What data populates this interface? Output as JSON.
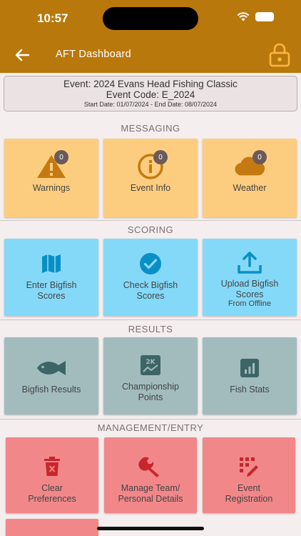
{
  "status": {
    "time": "10:57"
  },
  "appbar": {
    "title": "AFT Dashboard"
  },
  "event": {
    "name": "Event: 2024 Evans Head Fishing Classic",
    "code": "Event Code: E_2024",
    "dates": "Start Date: 01/07/2024 - End Date: 08/07/2024"
  },
  "sections": {
    "messaging": "MESSAGING",
    "scoring": "SCORING",
    "results": "RESULTS",
    "management": "MANAGEMENT/ENTRY"
  },
  "messaging": {
    "warnings": {
      "label": "Warnings",
      "badge": "0"
    },
    "event_info": {
      "label": "Event Info",
      "badge": "0"
    },
    "weather": {
      "label": "Weather",
      "badge": "0"
    }
  },
  "scoring": {
    "enter": {
      "label1": "Enter Bigfish",
      "label2": "Scores"
    },
    "check": {
      "label1": "Check Bigfish",
      "label2": "Scores"
    },
    "upload": {
      "label1": "Upload Bigfish",
      "label2": "Scores",
      "sub": "From Offline"
    }
  },
  "results": {
    "bigfish": {
      "label": "Bigfish Results"
    },
    "championship": {
      "label1": "Championship",
      "label2": "Points"
    },
    "fish_stats": {
      "label": "Fish Stats"
    }
  },
  "management": {
    "clear": {
      "label1": "Clear",
      "label2": "Preferences"
    },
    "team": {
      "label1": "Manage Team/",
      "label2": "Personal Details"
    },
    "registration": {
      "label1": "Event",
      "label2": "Registration"
    }
  },
  "colors": {
    "appbar": "#b9780c",
    "messaging": "#fdcd7f",
    "scoring": "#84d9f9",
    "results": "#a2bcbd",
    "management": "#f2878a",
    "icon_messaging": "#c47a10",
    "icon_scoring": "#0a8fc4",
    "icon_results": "#3d6568",
    "icon_management": "#c8262c"
  }
}
